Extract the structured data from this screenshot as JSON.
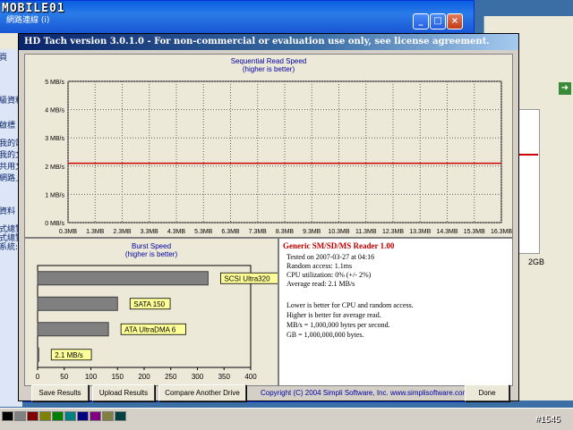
{
  "logo": {
    "text": "MOBILE01"
  },
  "watermark": {
    "text": "#1545"
  },
  "background_window": {
    "title": "網路連線 (i)",
    "sidebar_items": [
      "頁",
      "級資料",
      "啟標",
      "我的電",
      "我的文",
      "共用文",
      "網路上",
      "資料",
      "式總覽",
      "式總覽",
      "系統: F"
    ],
    "right_label": "2GB"
  },
  "hdtach": {
    "title": "HD Tach version 3.0.1.0  -  For non-commercial or evaluation use only, see license agreement.",
    "sequential": {
      "title": "Sequential Read Speed",
      "subtitle": "(higher is better)"
    },
    "burst": {
      "title": "Burst Speed",
      "subtitle": "(higher is better)"
    },
    "info": {
      "title": "Generic SM/SD/MS Reader 1.00",
      "lines": [
        "Tested on 2007-03-27 at 04:16",
        "Random access: 1.1ms",
        "CPU utilization: 0% (+/- 2%)",
        "Average read: 2.1 MB/s",
        "",
        "Lower is better for CPU and random access.",
        "Higher is better for average read.",
        "MB/s = 1,000,000 bytes per second.",
        "GB = 1,000,000,000 bytes."
      ]
    },
    "buttons": {
      "save": "Save Results",
      "upload": "Upload Results",
      "compare": "Compare Another Drive",
      "done": "Done"
    },
    "copyright": "Copyright (C) 2004 Simpli Software, Inc. www.simplisoftware.com"
  },
  "chart_data": [
    {
      "type": "line",
      "title": "Sequential Read Speed",
      "subtitle": "(higher is better)",
      "x_tick_labels": [
        "0.3MB",
        "1.3MB",
        "2.3MB",
        "3.3MB",
        "4.3MB",
        "5.3MB",
        "6.3MB",
        "7.3MB",
        "8.3MB",
        "9.3MB",
        "10.3MB",
        "11.3MB",
        "12.3MB",
        "13.3MB",
        "14.3MB",
        "15.3MB",
        "16.3MB"
      ],
      "y_tick_labels": [
        "0 MB/s",
        "1 MB/s",
        "2 MB/s",
        "3 MB/s",
        "4 MB/s",
        "5 MB/s"
      ],
      "ylim": [
        0,
        5
      ],
      "grid": true,
      "series": [
        {
          "values": [
            2.1,
            2.1,
            2.1,
            2.1,
            2.1,
            2.1,
            2.1,
            2.1,
            2.1,
            2.1,
            2.1,
            2.1,
            2.1,
            2.1,
            2.1,
            2.1,
            2.1
          ],
          "color": "#cc0000"
        }
      ]
    },
    {
      "type": "bar",
      "orientation": "horizontal",
      "title": "Burst Speed",
      "subtitle": "(higher is better)",
      "categories": [
        "SCSI Ultra320",
        "SATA 150",
        "ATA UltraDMA 6",
        "2.1 MB/s"
      ],
      "values": [
        320,
        150,
        133,
        2.1
      ],
      "xlim": [
        0,
        400
      ],
      "x_tick_labels": [
        "0",
        "50",
        "100",
        "150",
        "200",
        "250",
        "300",
        "350",
        "400"
      ],
      "bar_color": "#808080",
      "label_bg": "#ffff99"
    }
  ]
}
